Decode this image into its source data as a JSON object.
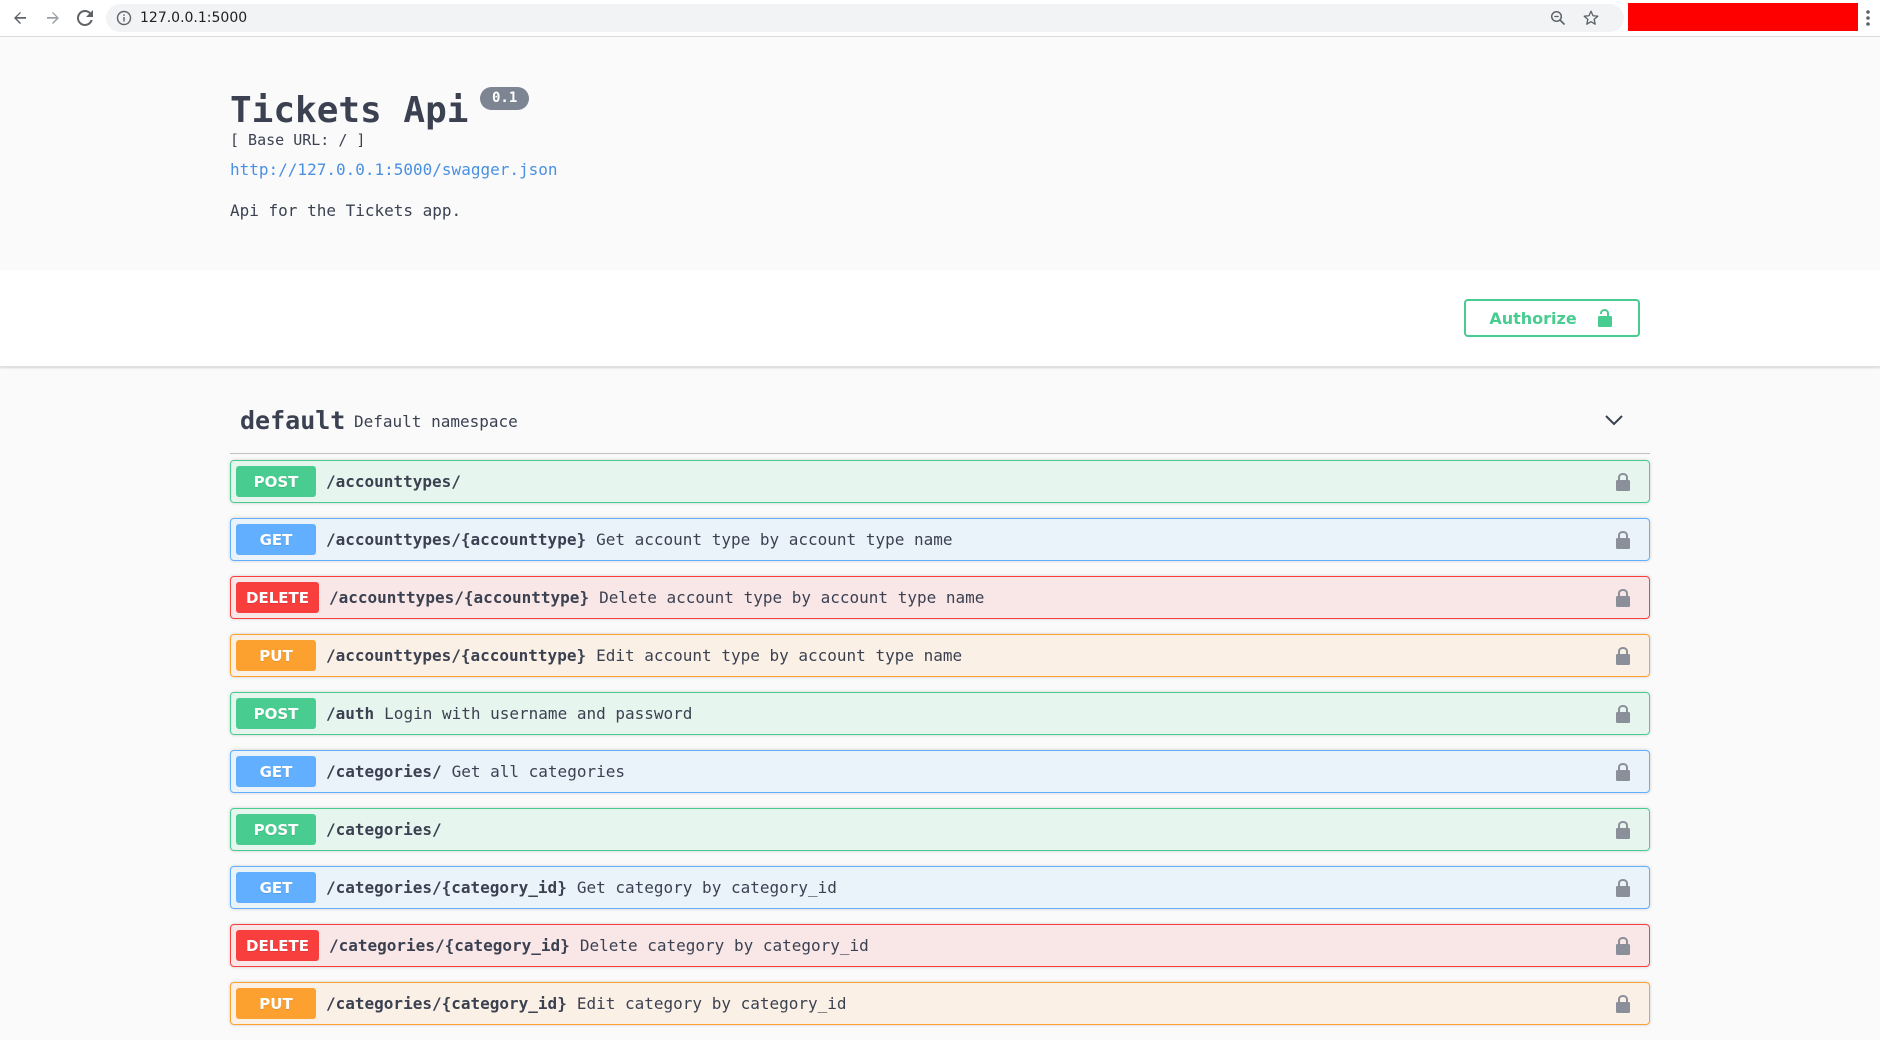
{
  "browser": {
    "url": "127.0.0.1:5000"
  },
  "info": {
    "title": "Tickets Api",
    "version": "0.1",
    "base_url": "[ Base URL: / ]",
    "spec_link": "http://127.0.0.1:5000/swagger.json",
    "description": "Api for the Tickets app."
  },
  "scheme": {
    "authorize_label": "Authorize"
  },
  "namespace": {
    "name": "default",
    "description": "Default namespace"
  },
  "operations": [
    {
      "method": "POST",
      "path": "/accounttypes/",
      "summary": ""
    },
    {
      "method": "GET",
      "path": "/accounttypes/{accounttype}",
      "summary": "Get account type by account type name"
    },
    {
      "method": "DELETE",
      "path": "/accounttypes/{accounttype}",
      "summary": "Delete account type by account type name"
    },
    {
      "method": "PUT",
      "path": "/accounttypes/{accounttype}",
      "summary": "Edit account type by account type name"
    },
    {
      "method": "POST",
      "path": "/auth",
      "summary": "Login with username and password"
    },
    {
      "method": "GET",
      "path": "/categories/",
      "summary": "Get all categories"
    },
    {
      "method": "POST",
      "path": "/categories/",
      "summary": ""
    },
    {
      "method": "GET",
      "path": "/categories/{category_id}",
      "summary": "Get category by category_id"
    },
    {
      "method": "DELETE",
      "path": "/categories/{category_id}",
      "summary": "Delete category by category_id"
    },
    {
      "method": "PUT",
      "path": "/categories/{category_id}",
      "summary": "Edit category by category_id"
    }
  ],
  "colors": {
    "post": "#49cc90",
    "get": "#61affe",
    "delete": "#f93e3e",
    "put": "#fca130",
    "text": "#3b4151",
    "link": "#4990e2"
  },
  "icons": {
    "back": "arrow-left-icon",
    "forward": "arrow-right-icon",
    "reload": "reload-icon",
    "site_info": "info-icon",
    "zoom": "zoom-icon",
    "bookmark": "star-icon",
    "menu": "kebab-menu-icon",
    "authorize": "unlocked-icon",
    "operation_lock": "lock-icon",
    "namespace_toggle": "chevron-down-icon"
  }
}
